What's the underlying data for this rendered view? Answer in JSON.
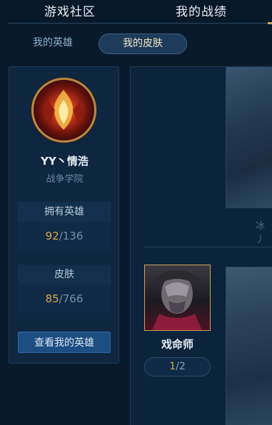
{
  "top_tabs": {
    "community": "游戏社区",
    "records": "我的战绩"
  },
  "sub_tabs": {
    "heroes": "我的英雄",
    "skins": "我的皮肤"
  },
  "profile": {
    "name": "YY丶情浩",
    "school": "战争学院",
    "heroes_label": "拥有英雄",
    "heroes_owned": "92",
    "heroes_total": "/136",
    "skins_label": "皮肤",
    "skins_owned": "85",
    "skins_total": "/766",
    "view_button": "查看我的英雄"
  },
  "content": {
    "skin_caption": "冰丿",
    "hero": {
      "name": "戏命师",
      "owned": "1",
      "total": "/2"
    }
  },
  "colors": {
    "accent_gold": "#e3a34c",
    "button_blue": "#1d4e82",
    "background": "#081a2c"
  }
}
